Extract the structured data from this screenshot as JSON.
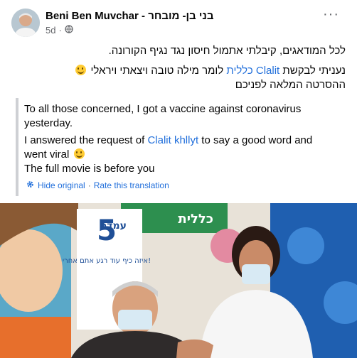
{
  "post": {
    "author": "Beni Ben Muvchar - בני בן- מובחר",
    "time": "5d",
    "hebrew": {
      "line1": "לכל המודאגים, קיבלתי אתמול חיסון נגד נגיף הקורונה.",
      "line2_before": "נעניתי לבקשת ",
      "line2_link": "Clalit כללית",
      "line2_after": " לומר מילה טובה ויצאתי ויראלי",
      "line3": "ההסרטה המלאה לפניכם"
    },
    "translation": {
      "para1": "To all those concerned, I got a vaccine against coronavirus yesterday.",
      "para2_before": "I answered the request of ",
      "para2_link": "Clalit khllyt",
      "para2_after": " to say a good word and went viral",
      "para3": "The full movie is before you"
    },
    "actions": {
      "hide_original": "Hide original",
      "separator": "·",
      "rate_translation": "Rate this translation"
    },
    "photo": {
      "sign_number": "5",
      "sign_title": "עמדה",
      "sign_text": "איזה כיף עוד רגע אתם אחרי!",
      "banner_text": "כללית"
    }
  }
}
